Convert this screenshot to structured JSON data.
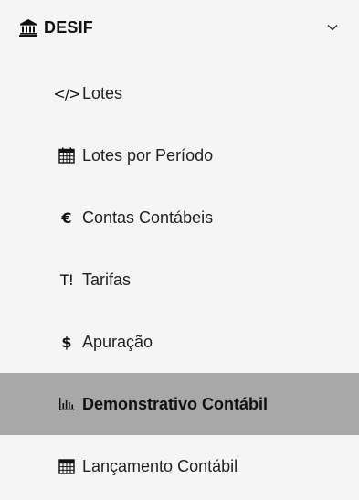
{
  "group": {
    "title": "DESIF",
    "icon": "bank-icon",
    "expanded": true
  },
  "items": [
    {
      "label": "Lotes",
      "icon": "code-icon",
      "glyph": "</>",
      "active": false
    },
    {
      "label": "Lotes por Período",
      "icon": "calendar-icon",
      "active": false
    },
    {
      "label": "Contas Contábeis",
      "icon": "euro-icon",
      "glyph": "€",
      "active": false
    },
    {
      "label": "Tarifas",
      "icon": "text-height-icon",
      "glyph": "T!",
      "active": false
    },
    {
      "label": "Apuração",
      "icon": "dollar-icon",
      "glyph": "$",
      "active": false
    },
    {
      "label": "Demonstrativo Contábil",
      "icon": "bar-chart-icon",
      "active": true
    },
    {
      "label": "Lançamento Contábil",
      "icon": "calculator-icon",
      "active": false
    }
  ],
  "colors": {
    "background": "#f5f5f5",
    "active_background": "#a8a8a8",
    "text": "#222222"
  }
}
